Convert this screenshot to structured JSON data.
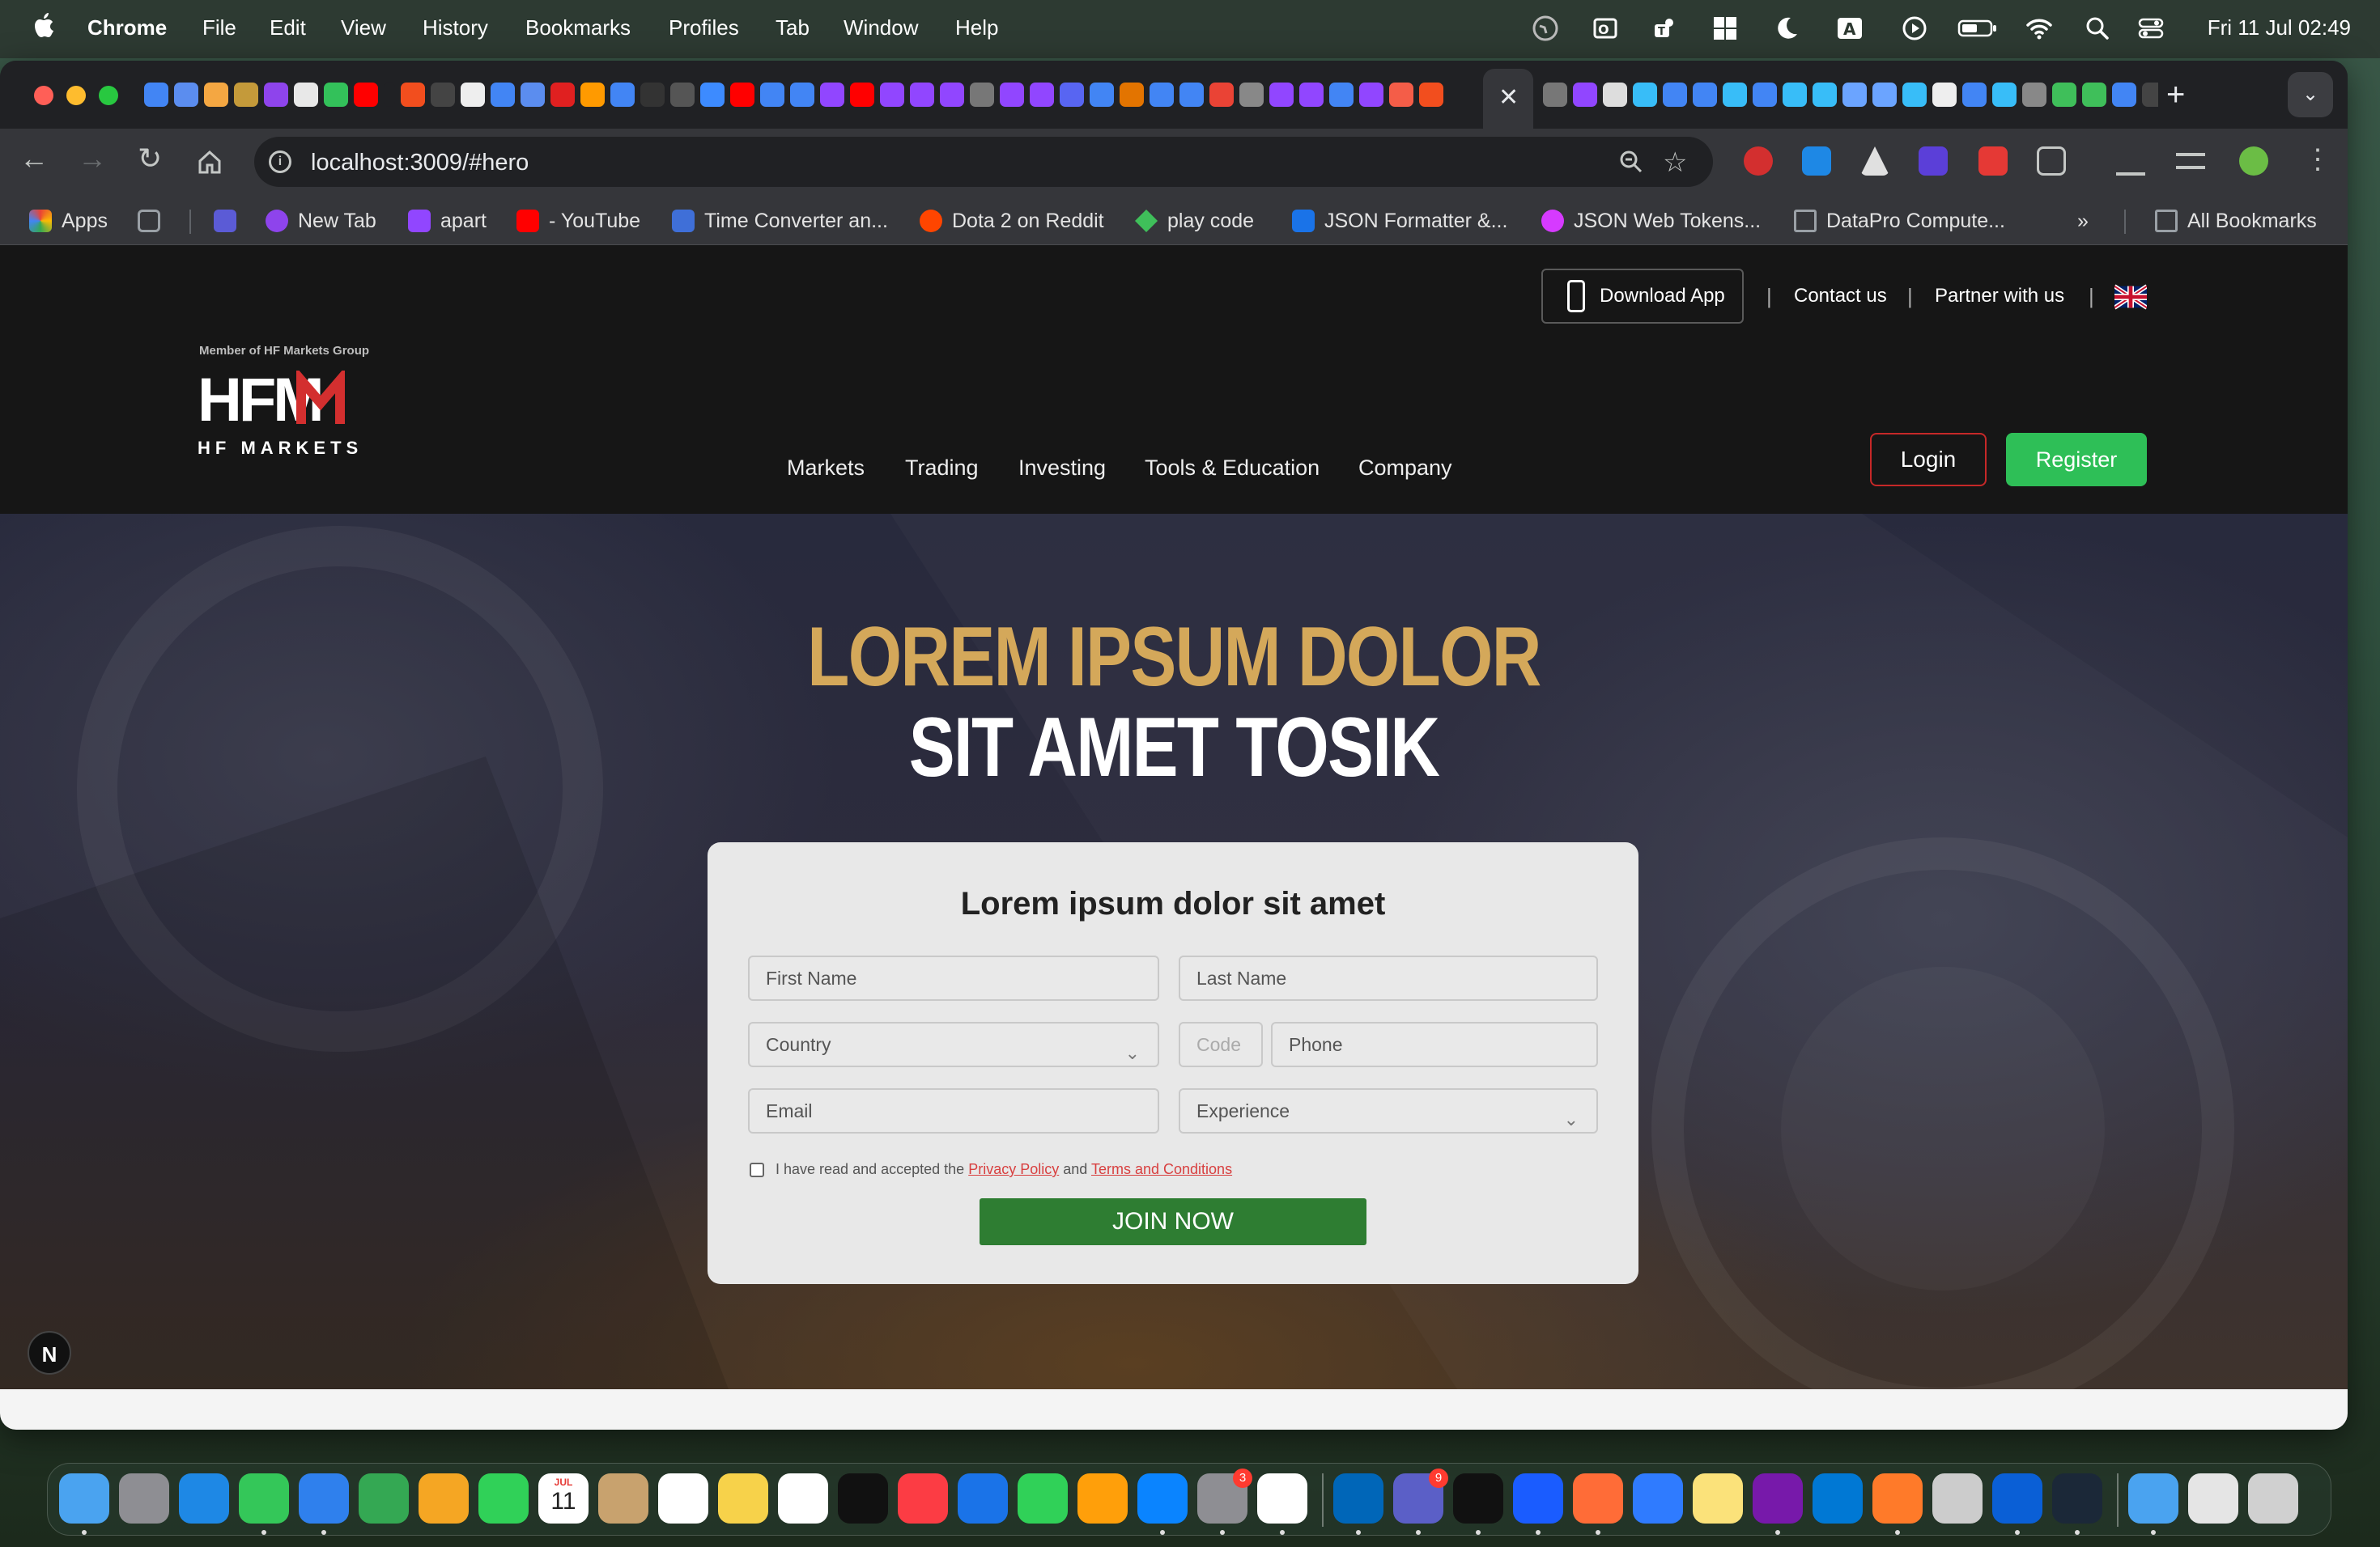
{
  "menubar": {
    "app_name": "Chrome",
    "items": [
      "File",
      "Edit",
      "View",
      "History",
      "Bookmarks",
      "Profiles",
      "Tab",
      "Window",
      "Help"
    ],
    "clock": "Fri 11 Jul  02:49",
    "status_icons": [
      "vpn-icon",
      "outlook-icon",
      "teams-icon",
      "windows-icon",
      "moon-icon",
      "input-source-icon",
      "play-icon",
      "battery-icon",
      "wifi-icon",
      "spotlight-icon",
      "control-center-icon"
    ]
  },
  "browser": {
    "url": "localhost:3009/#hero",
    "bookmarks": [
      {
        "label": "Apps",
        "icon": "apps-grid-icon",
        "color": "#ea4335"
      },
      {
        "label": "",
        "icon": "tab-groups-icon",
        "color": "#9aa0a6"
      },
      {
        "label": "",
        "icon": "bolt-icon",
        "color": "#5b5bd6"
      },
      {
        "label": "New Tab",
        "icon": "new-tab-icon",
        "color": "#8e44ec"
      },
      {
        "label": "apart",
        "icon": "twitch-icon",
        "color": "#9146ff"
      },
      {
        "label": "- YouTube",
        "icon": "youtube-icon",
        "color": "#ff0000"
      },
      {
        "label": "Time Converter an...",
        "icon": "time-converter-icon",
        "color": "#3f6fd8"
      },
      {
        "label": "Dota 2 on Reddit",
        "icon": "reddit-icon",
        "color": "#ff4500"
      },
      {
        "label": "play code",
        "icon": "code-icon",
        "color": "#3fbf5a"
      },
      {
        "label": "JSON Formatter &...",
        "icon": "check-icon",
        "color": "#1a73e8"
      },
      {
        "label": "JSON Web Tokens...",
        "icon": "jwt-icon",
        "color": "#d63aff"
      },
      {
        "label": "DataPro Compute...",
        "icon": "folder-icon",
        "color": "#9aa0a6"
      }
    ],
    "all_bookmarks": "All Bookmarks",
    "more_bookmarks": "»"
  },
  "site": {
    "topbar": {
      "download_app": "Download App",
      "contact": "Contact us",
      "partner": "Partner with us"
    },
    "logo": {
      "member_text": "Member of HF Markets Group",
      "wordmark": "HFM",
      "subtitle": "HF MARKETS"
    },
    "nav": [
      "Markets",
      "Trading",
      "Investing",
      "Tools & Education",
      "Company"
    ],
    "login": "Login",
    "register": "Register",
    "colors": {
      "gold": "#d4a85a",
      "register_green": "#2ebf57",
      "join_green": "#2e7d32",
      "brand_red": "#d32f2f"
    }
  },
  "hero": {
    "headline_line1": "LOREM IPSUM DOLOR",
    "headline_line2": "SIT AMET TOSIK",
    "form": {
      "title": "Lorem ipsum dolor sit amet",
      "first_name": "First Name",
      "last_name": "Last Name",
      "country": "Country",
      "code": "Code",
      "phone": "Phone",
      "email": "Email",
      "experience": "Experience",
      "agree_prefix": "I have read and accepted the",
      "privacy": "Privacy Policy",
      "and": "and",
      "terms": "Terms and Conditions",
      "submit": "JOIN NOW"
    }
  },
  "overlay": {
    "n_toggle": "N"
  },
  "dock": {
    "apps": [
      "finder",
      "launchpad",
      "safari",
      "messages",
      "mail",
      "maps",
      "photos",
      "facetime",
      "calendar",
      "contacts",
      "reminders",
      "notes",
      "freeform",
      "tv",
      "music",
      "keynote",
      "numbers",
      "pages",
      "app-store",
      "system-settings",
      "chrome",
      "vscode",
      "teams",
      "terminal",
      "copilot",
      "postman",
      "maps-pin",
      "stickies",
      "onenote",
      "outlook",
      "pen",
      "remote-desktop",
      "windows-app",
      "steam",
      "downloads",
      "finder-window",
      "trash"
    ],
    "calendar_day": "11",
    "calendar_month": "JUL",
    "badges": {
      "system_settings": "3",
      "teams": "9"
    }
  }
}
